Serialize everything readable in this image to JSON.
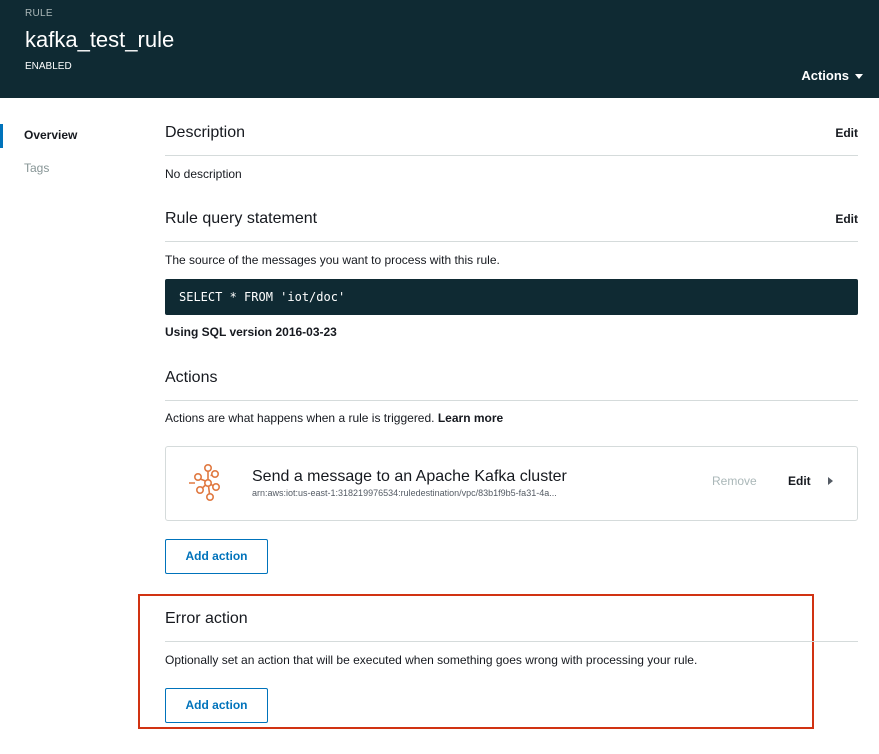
{
  "header": {
    "eyebrow": "RULE",
    "title": "kafka_test_rule",
    "status": "ENABLED",
    "actions_label": "Actions",
    "background": "#0f2a33"
  },
  "sidenav": {
    "items": [
      {
        "label": "Overview",
        "active": true
      },
      {
        "label": "Tags",
        "active": false
      }
    ]
  },
  "description": {
    "title": "Description",
    "edit_label": "Edit",
    "text": "No description"
  },
  "query": {
    "title": "Rule query statement",
    "edit_label": "Edit",
    "intro": "The source of the messages you want to process with this rule.",
    "sql": "SELECT * FROM 'iot/doc'",
    "sql_version": "Using SQL version 2016-03-23"
  },
  "actions": {
    "title": "Actions",
    "intro": "Actions are what happens when a rule is triggered.",
    "learn_more": "Learn more",
    "items": [
      {
        "icon": "kafka-icon",
        "title": "Send a message to an Apache Kafka cluster",
        "arn": "arn:aws:iot:us-east-1:318219976534:ruledestination/vpc/83b1f9b5-fa31-4a...",
        "remove_label": "Remove",
        "edit_label": "Edit"
      }
    ],
    "add_label": "Add action"
  },
  "error_action": {
    "title": "Error action",
    "intro": "Optionally set an action that will be executed when something goes wrong with processing your rule.",
    "add_label": "Add action",
    "highlight_color": "#d13212"
  },
  "colors": {
    "accent": "#0073bb",
    "icon_orange": "#e07941"
  }
}
